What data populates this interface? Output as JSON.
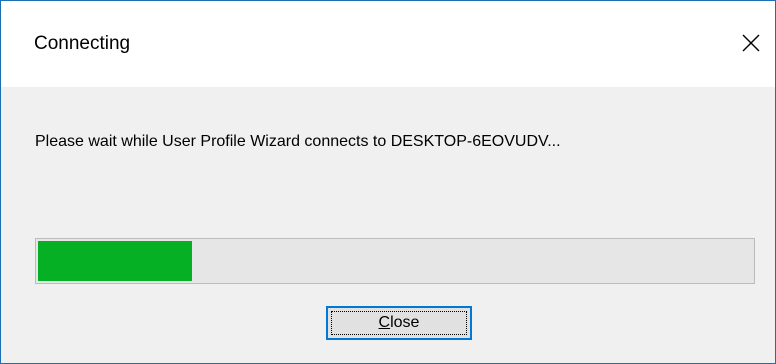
{
  "dialog": {
    "title": "Connecting",
    "message": "Please wait while User Profile Wizard connects to DESKTOP-6EOVUDV...",
    "close_icon": "close-icon",
    "progress_fraction": 0.215,
    "progress_color": "#06b025",
    "close_button": {
      "mnemonic": "C",
      "rest": "lose"
    }
  }
}
